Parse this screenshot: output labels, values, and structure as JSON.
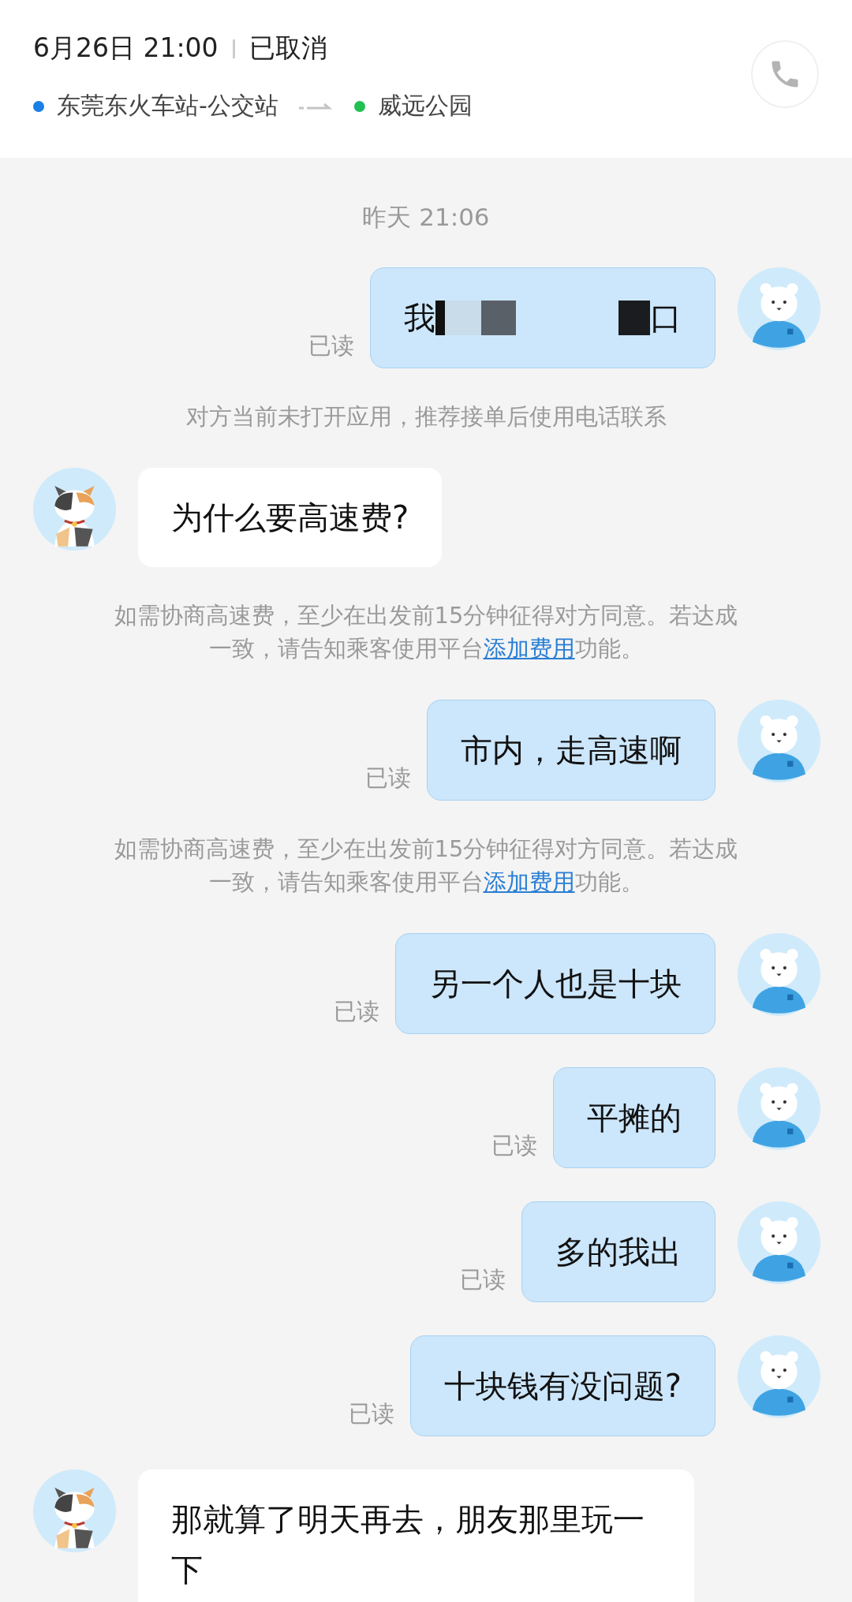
{
  "header": {
    "datetime": "6月26日 21:00",
    "status": "已取消",
    "origin": {
      "name": "东莞东火车站-公交站",
      "color": "#1a7fe6"
    },
    "destination": {
      "name": "威远公园",
      "color": "#21c053"
    }
  },
  "chat": [
    {
      "kind": "time",
      "text": "昨天  21:06"
    },
    {
      "kind": "message",
      "outgoing": true,
      "text": "我",
      "text_end": "口",
      "redacted": true,
      "read_label": "已读"
    },
    {
      "kind": "notice",
      "text": "对方当前未打开应用，推荐接单后使用电话联系"
    },
    {
      "kind": "message",
      "outgoing": false,
      "text": "为什么要高速费?"
    },
    {
      "kind": "notice",
      "text": "如需协商高速费，至少在出发前15分钟征得对方同意。若达成一致，请告知乘客使用平台",
      "link": "添加费用",
      "text_after": "功能。"
    },
    {
      "kind": "message",
      "outgoing": true,
      "text": "市内，走高速啊",
      "read_label": "已读"
    },
    {
      "kind": "notice",
      "text": "如需协商高速费，至少在出发前15分钟征得对方同意。若达成一致，请告知乘客使用平台",
      "link": "添加费用",
      "text_after": "功能。"
    },
    {
      "kind": "message",
      "outgoing": true,
      "text": "另一个人也是十块",
      "read_label": "已读"
    },
    {
      "kind": "message",
      "outgoing": true,
      "text": "平摊的",
      "read_label": "已读"
    },
    {
      "kind": "message",
      "outgoing": true,
      "text": "多的我出",
      "read_label": "已读"
    },
    {
      "kind": "message",
      "outgoing": true,
      "text": "十块钱有没问题?",
      "read_label": "已读"
    },
    {
      "kind": "message",
      "outgoing": false,
      "text": "那就算了明天再去，朋友那里玩一下"
    }
  ]
}
